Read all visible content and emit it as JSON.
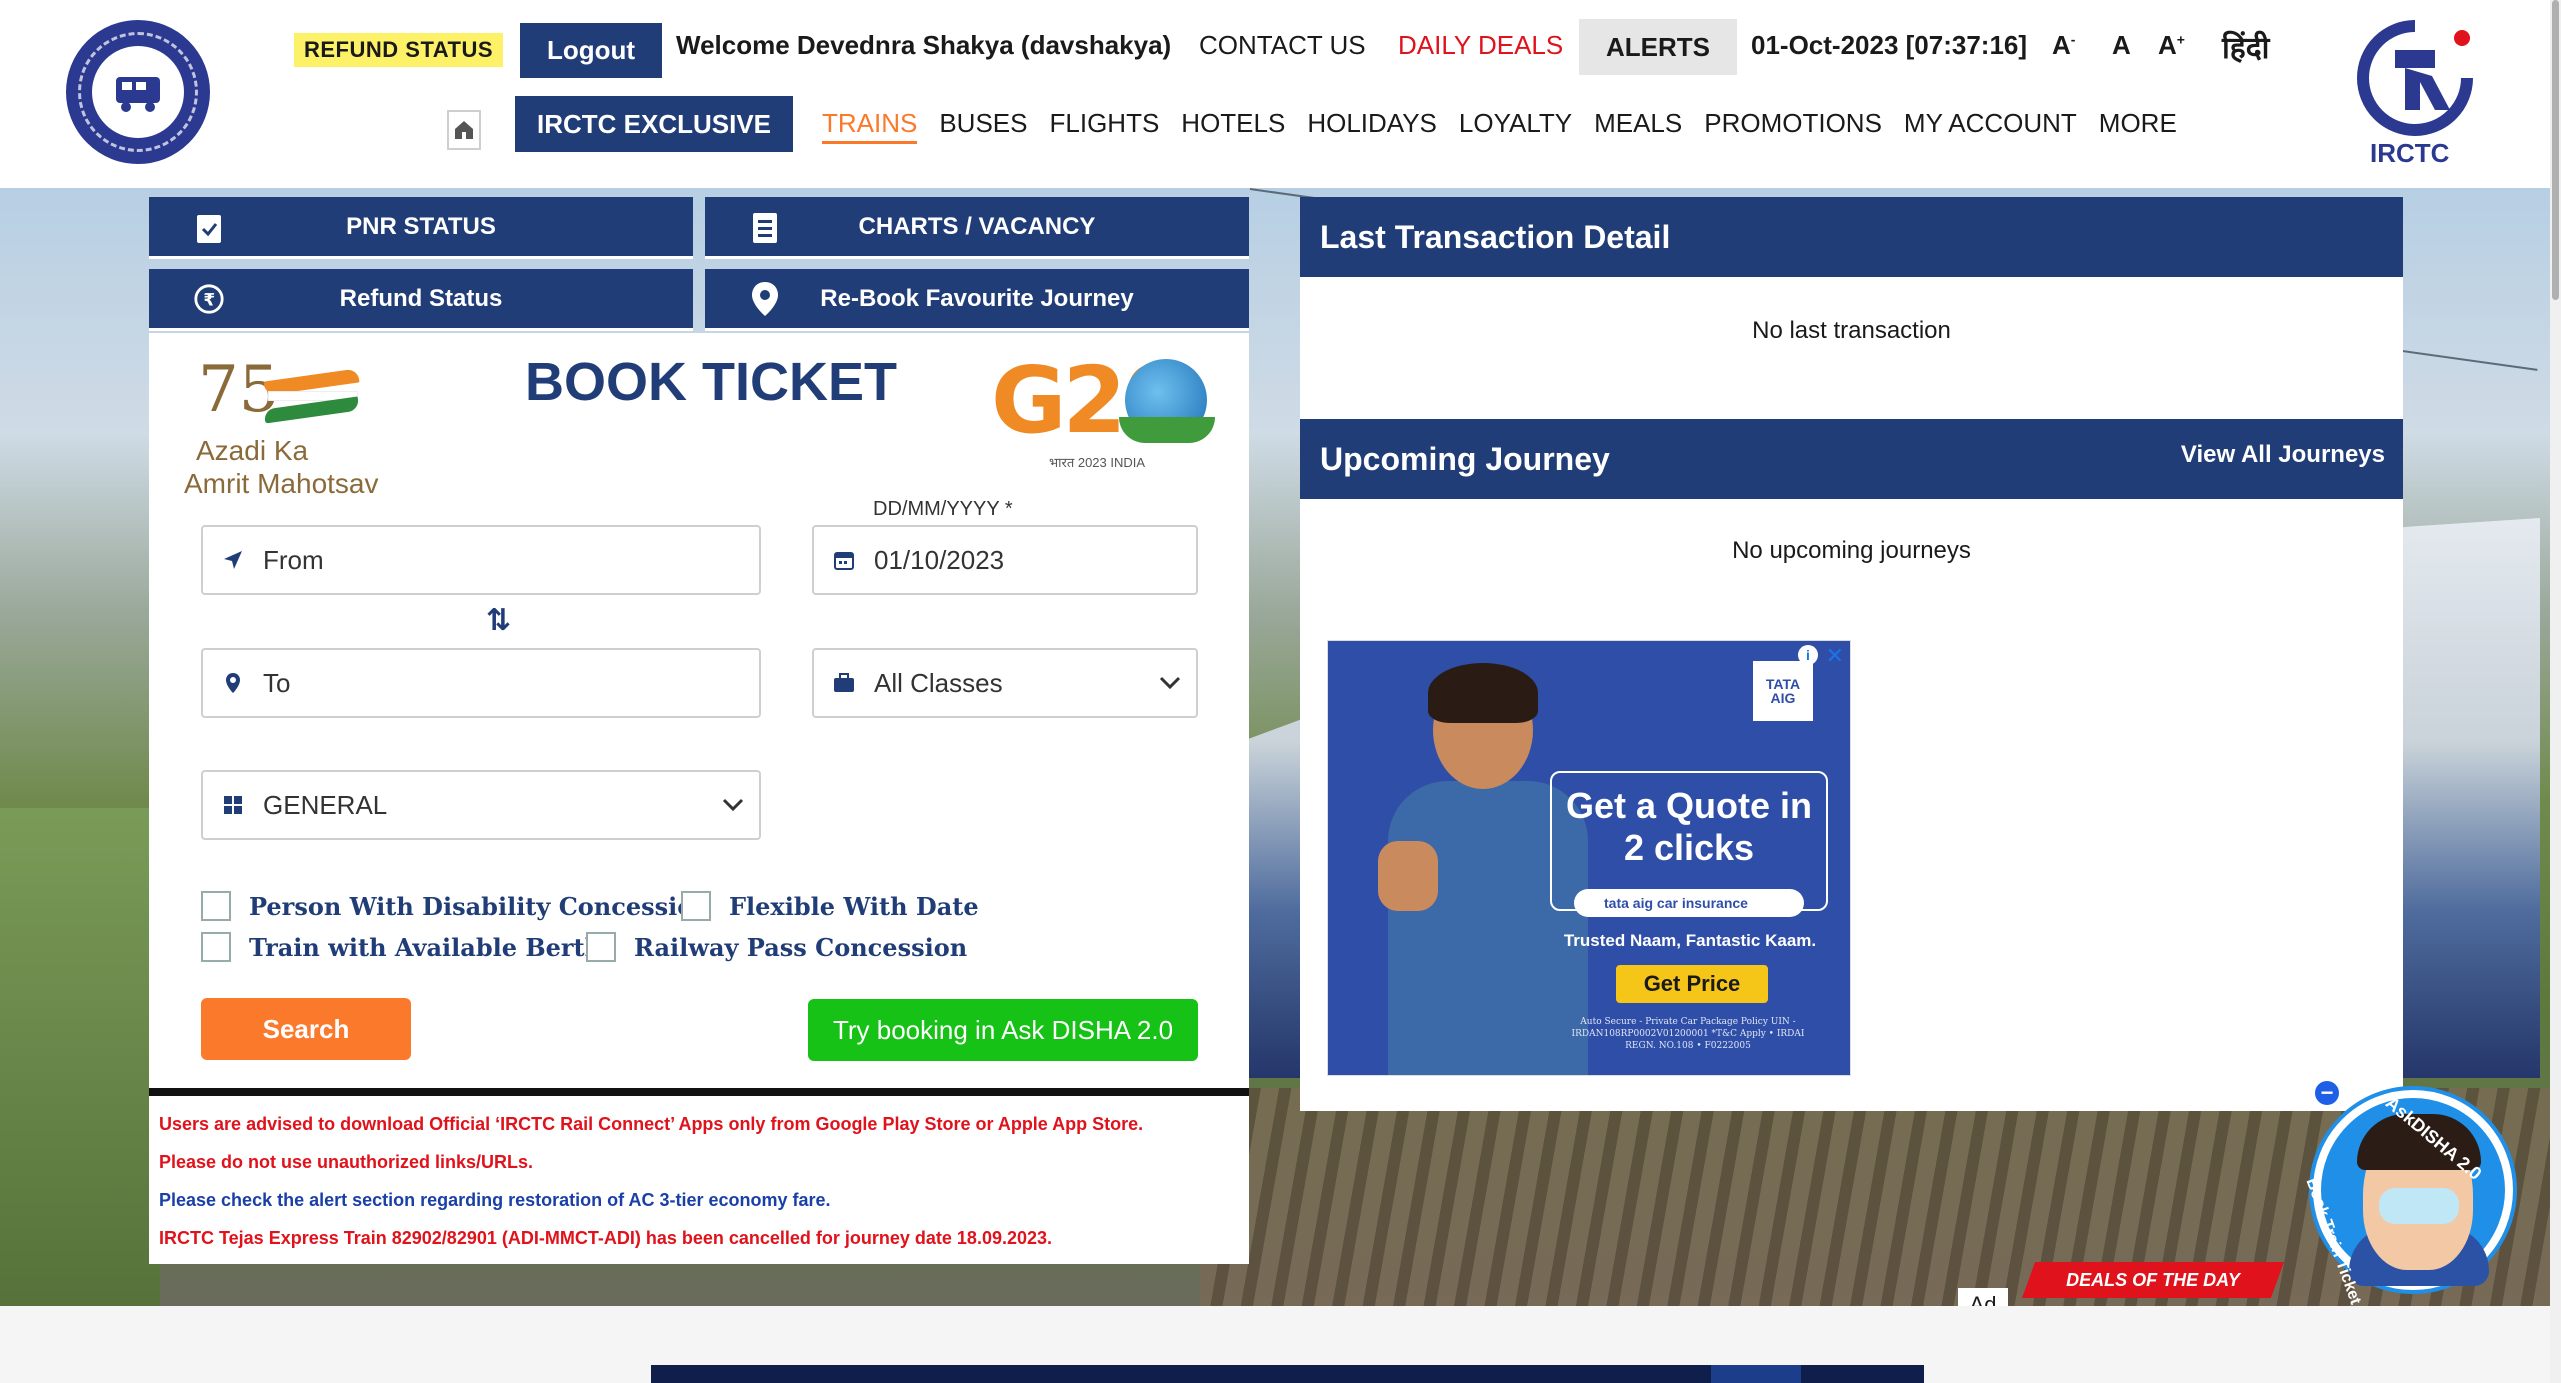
{
  "header": {
    "refund_status": "REFUND STATUS",
    "logout": "Logout",
    "welcome": "Welcome Devednra Shakya (davshakya)",
    "contact_us": "CONTACT US",
    "daily_deals": "DAILY DEALS",
    "alerts": "ALERTS",
    "datetime": "01-Oct-2023 [07:37:16]",
    "font_decrease": "A",
    "font_normal": "A",
    "font_increase": "A",
    "hindi": "हिंदी",
    "irctc_exclusive": "IRCTC EXCLUSIVE",
    "irctc_logo_text": "IRCTC"
  },
  "nav": {
    "items": [
      "TRAINS",
      "BUSES",
      "FLIGHTS",
      "HOTELS",
      "HOLIDAYS",
      "LOYALTY",
      "MEALS",
      "PROMOTIONS",
      "MY ACCOUNT",
      "MORE"
    ],
    "active": "TRAINS"
  },
  "quick_actions": {
    "pnr_status": "PNR STATUS",
    "charts_vacancy": "CHARTS / VACANCY",
    "refund_status": "Refund Status",
    "rebook": "Re-Book Favourite Journey"
  },
  "book_ticket": {
    "title": "BOOK TICKET",
    "azadi_75": "75",
    "azadi_line1": "Azadi Ka",
    "azadi_line2": "Amrit Mahotsav",
    "g20_text": "G20",
    "g20_sub": "भारत 2023 INDIA",
    "date_label": "DD/MM/YYYY *",
    "from_placeholder": "From",
    "to_placeholder": "To",
    "date_value": "01/10/2023",
    "class_value": "All Classes",
    "quota_value": "GENERAL",
    "checkboxes": {
      "disability": "Person With Disability Concession",
      "flexible": "Flexible With Date",
      "available_berth": "Train with Available Berth",
      "railway_pass": "Railway Pass Concession"
    },
    "search": "Search",
    "disha_booking": "Try booking in Ask DISHA 2.0"
  },
  "notices": [
    "Users are advised to download Official ‘IRCTC Rail Connect’ Apps only from Google Play Store or Apple App Store.",
    "Please do not use unauthorized links/URLs.",
    "Please check the alert section regarding restoration of AC 3-tier economy fare.",
    "IRCTC Tejas Express Train 82902/82901 (ADI-MMCT-ADI) has been cancelled for journey date 18.09.2023."
  ],
  "last_transaction": {
    "title": "Last Transaction Detail",
    "empty": "No last transaction"
  },
  "upcoming_journey": {
    "title": "Upcoming Journey",
    "view_all": "View All Journeys",
    "empty": "No upcoming journeys"
  },
  "ad": {
    "brand": "TATA AIG",
    "headline": "Get a Quote in 2 clicks",
    "search_text": "tata aig car insurance",
    "tagline": "Trusted Naam, Fantastic Kaam.",
    "cta": "Get Price",
    "fine_print": "Auto Secure - Private Car Package Policy UIN - IRDAN108RP0002V01200001 *T&C Apply • IRDAI REGN. NO.108 • F0222005",
    "info": "i",
    "close": "✕"
  },
  "disha": {
    "label": "AskDISHA 2.0",
    "sub": "Book Train Ticket",
    "minimize": "−"
  },
  "deals_banner": "DEALS OF THE DAY",
  "ad_marker": "Ad",
  "colors": {
    "primary": "#213d77",
    "accent_orange": "#fb792b",
    "green": "#15c215",
    "alert_red": "#e0121b",
    "notice_blue": "#1a3fa8"
  }
}
